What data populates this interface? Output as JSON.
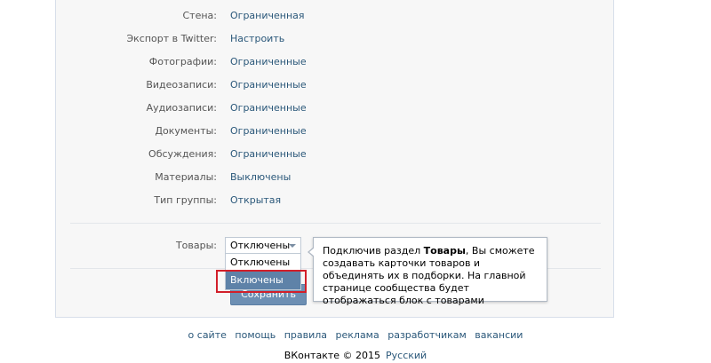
{
  "settings": [
    {
      "label": "Стена:",
      "value": "Ограниченная"
    },
    {
      "label": "Экспорт в Twitter:",
      "value": "Настроить"
    },
    {
      "label": "Фотографии:",
      "value": "Ограниченные"
    },
    {
      "label": "Видеозаписи:",
      "value": "Ограниченные"
    },
    {
      "label": "Аудиозаписи:",
      "value": "Ограниченные"
    },
    {
      "label": "Документы:",
      "value": "Ограниченные"
    },
    {
      "label": "Обсуждения:",
      "value": "Ограниченные"
    },
    {
      "label": "Материалы:",
      "value": "Выключены"
    },
    {
      "label": "Тип группы:",
      "value": "Открытая"
    }
  ],
  "goods": {
    "label": "Товары:",
    "selected": "Отключены",
    "options": [
      "Отключены",
      "Включены"
    ],
    "highlighted_option": "Включены"
  },
  "tooltip": {
    "prefix": "Подключив раздел ",
    "bold": "Товары",
    "suffix": ", Вы сможете создавать карточки товаров и объединять их в подборки. На главной странице сообщества будет отображаться блок с товарами"
  },
  "save_label": "Сохранить",
  "footer": {
    "links": [
      "о сайте",
      "помощь",
      "правила",
      "реклама",
      "разработчикам",
      "вакансии"
    ],
    "copyright": "ВКонтакте © 2015",
    "language": "Русский"
  },
  "colors": {
    "link": "#2b587a",
    "highlight_border": "#d21f2a",
    "selected_option": "#5e82a8",
    "button": "#6d8fb3"
  }
}
